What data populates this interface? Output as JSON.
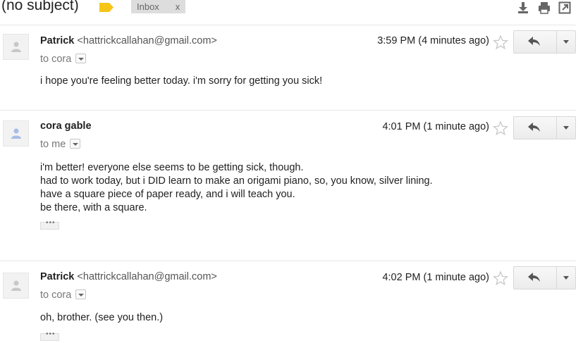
{
  "header": {
    "subject": "(no subject)",
    "label_chip": "Inbox",
    "label_chip_close": "x",
    "icons": [
      "download-icon",
      "print-icon",
      "new-window-icon"
    ]
  },
  "colors": {
    "label_tag": "#f5c518",
    "divider": "#e5e5e5",
    "avatar_person": "#a7bde8"
  },
  "messages": [
    {
      "sender_name": "Patrick",
      "sender_email": "<hattrickcallahan@gmail.com>",
      "to": "to cora",
      "time": "3:59 PM (4 minutes ago)",
      "body": [
        "i hope you're feeling better today. i'm sorry for getting you sick!"
      ]
    },
    {
      "sender_name": "cora gable",
      "sender_email": "",
      "to": "to me",
      "time": "4:01 PM (1 minute ago)",
      "body": [
        "i'm better! everyone else seems to be getting sick, though.",
        "had to work today, but i DID learn to make an origami piano, so, you know, silver lining.",
        "have a square piece of paper ready, and i will teach you.",
        "be there, with a square."
      ],
      "ellipsis": "•••"
    },
    {
      "sender_name": "Patrick",
      "sender_email": "<hattrickcallahan@gmail.com>",
      "to": "to cora",
      "time": "4:02 PM (1 minute ago)",
      "body": [
        "oh, brother. (see you then.)"
      ],
      "ellipsis": "•••"
    }
  ]
}
